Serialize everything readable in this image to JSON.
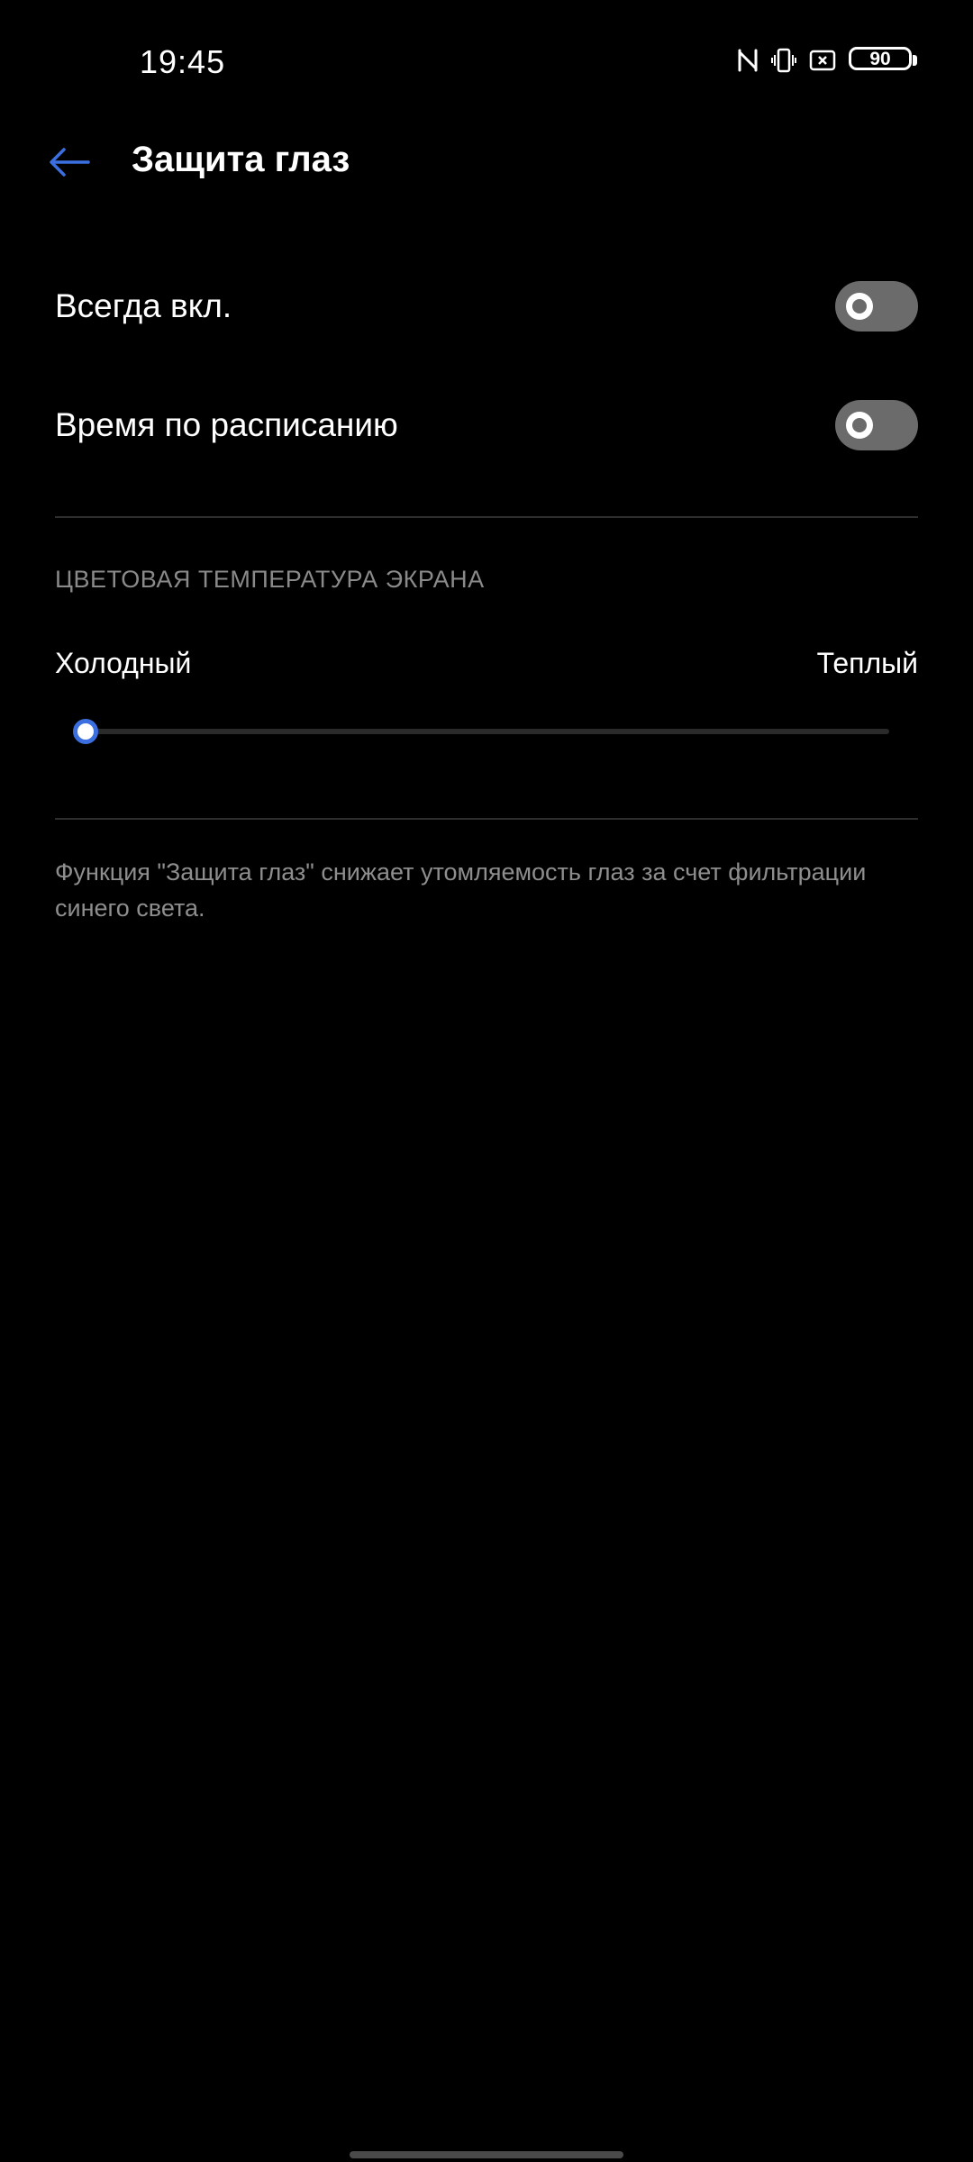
{
  "status_bar": {
    "time": "19:45",
    "icons": [
      "nfc-icon",
      "vibrate-icon",
      "screenshot-icon",
      "battery-icon"
    ],
    "battery_level": "90"
  },
  "header": {
    "back_icon": "arrow-left-icon",
    "title": "Защита глаз"
  },
  "settings": {
    "always_on": {
      "label": "Всегда вкл.",
      "enabled": false
    },
    "scheduled": {
      "label": "Время по расписанию",
      "enabled": false
    }
  },
  "color_temperature": {
    "section_title": "ЦВЕТОВАЯ ТЕМПЕРАТУРА ЭКРАНА",
    "min_label": "Холодный",
    "max_label": "Теплый",
    "value_fraction": 0.0
  },
  "footer": {
    "note": "Функция \"Защита глаз\" снижает утомляемость глаз за счет фильтрации синего света."
  },
  "colors": {
    "accent": "#3b6fe0",
    "background": "#000000",
    "toggle_off": "#6b6b6b",
    "secondary_text": "#8e8e8e"
  }
}
